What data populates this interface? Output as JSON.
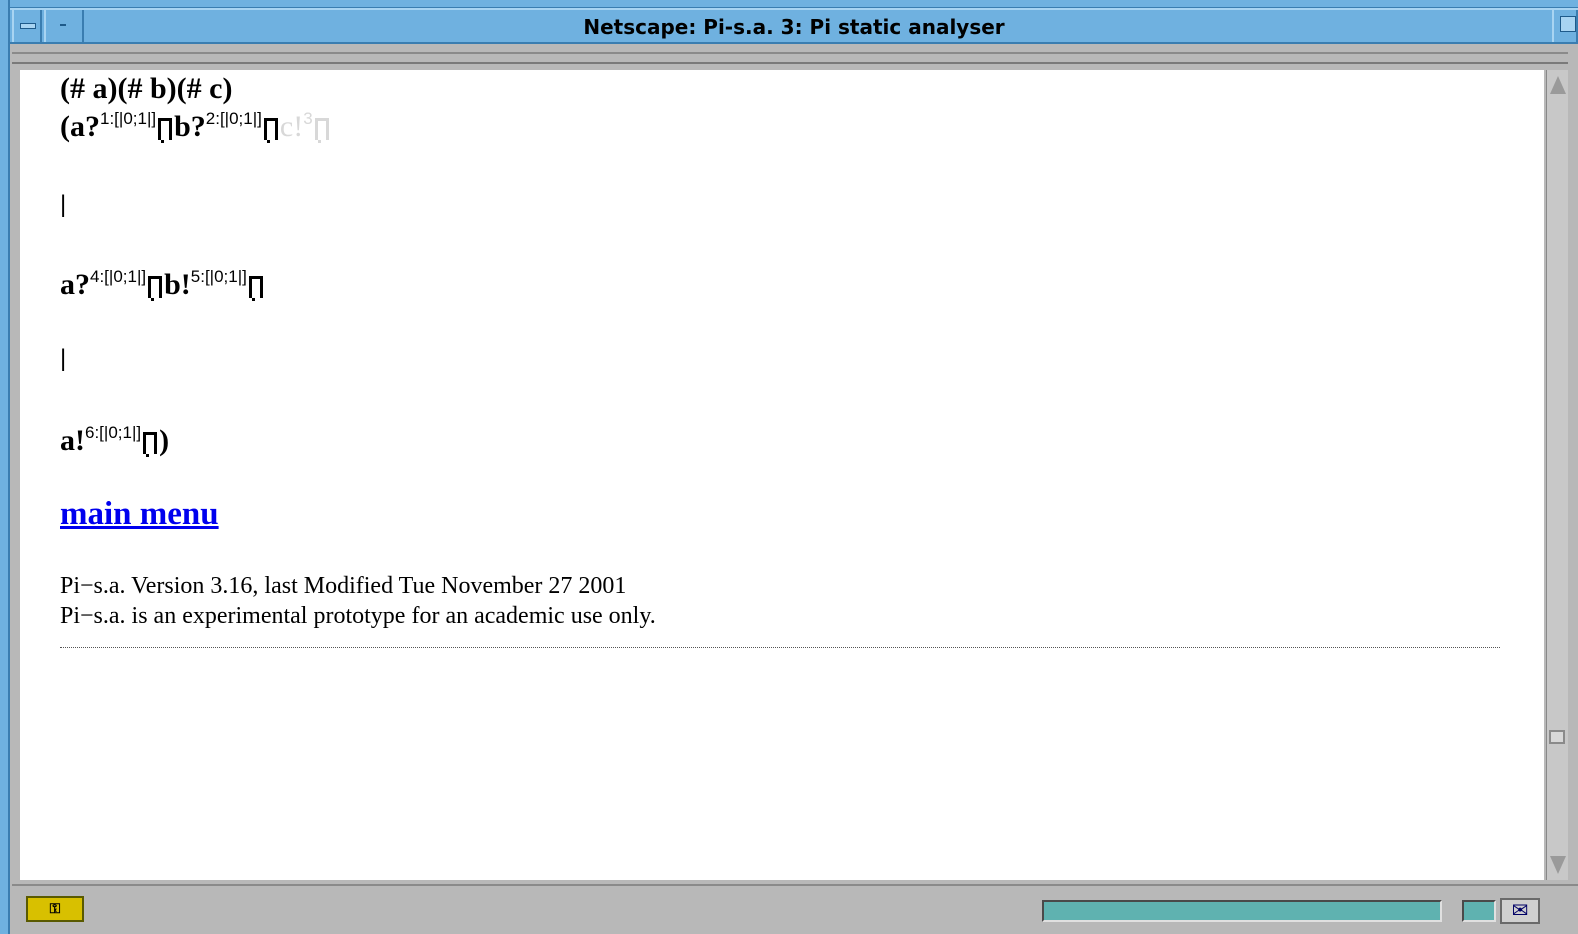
{
  "window": {
    "title": "Netscape: Pi-s.a. 3: Pi static analyser",
    "colors": {
      "titlebar": "#6fb1e0",
      "link": "#0000ee",
      "dimmed": "#d8d8d8",
      "progress": "#5fb2b0"
    }
  },
  "content": {
    "restriction_line": "(# a)(# b)(# c)",
    "process_1": {
      "open_paren": "(",
      "a_input": "a?",
      "a_input_label": "1:[|0;1|]",
      "b_input": "b?",
      "b_input_label": "2:[|0;1|]",
      "c_output": "c!",
      "c_output_label": "3"
    },
    "separator_1": "|",
    "process_2": {
      "a_input": "a?",
      "a_input_label": "4:[|0;1|]",
      "b_output": "b!",
      "b_output_label": "5:[|0;1|]"
    },
    "separator_2": "|",
    "process_3": {
      "a_output": "a!",
      "a_output_label": "6:[|0;1|]",
      "close_paren": ")"
    },
    "main_menu_link": "main menu",
    "footer": {
      "version_line": "Pi−s.a. Version 3.16, last Modified Tue November 27 2001",
      "disclaimer_line": "Pi−s.a. is an experimental prototype for an academic use only."
    }
  },
  "statusbar": {
    "security_icon": "key-lock-icon",
    "mail_icon": "mail-envelope-icon",
    "mail_glyph": "✉",
    "security_glyph": "⚿"
  }
}
